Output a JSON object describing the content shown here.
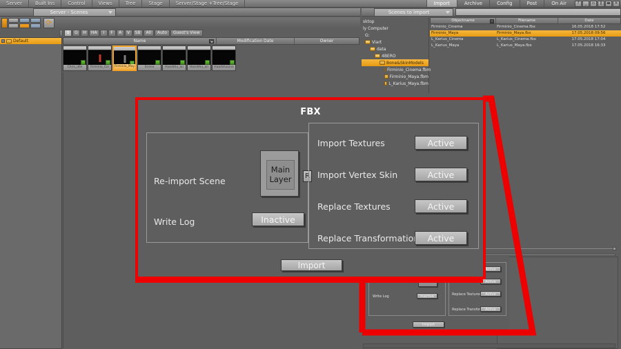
{
  "menu": {
    "items": [
      "Server",
      "Built Ins",
      "Control",
      "Views",
      "Tree",
      "Stage",
      "Server/Stage +Tree/Stage"
    ],
    "right_tabs": [
      {
        "label": "Import",
        "active": true
      },
      {
        "label": "Archive",
        "active": false
      },
      {
        "label": "Config",
        "active": false
      },
      {
        "label": "Post",
        "active": false
      },
      {
        "label": "On Air",
        "active": false
      }
    ],
    "window_buttons": [
      "help-icon",
      "minimize-icon",
      "restore-icon",
      "split-icon",
      "collapse-icon",
      "close-icon"
    ]
  },
  "left_pane": {
    "tab_label": "Server - Scenes",
    "toolbar_icons": [
      "lock-icon",
      "add-icon",
      "remove-icon",
      "folder-new-icon",
      "folder-up-icon",
      "list-icon",
      "list-detail-icon",
      "refresh-icon"
    ],
    "filters": [
      "S",
      "G",
      "H",
      "HA",
      "I",
      "F",
      "A",
      "V",
      "SB",
      "All",
      "Auto",
      "Guest's View"
    ],
    "filter_active": "Guest's View",
    "tree": [
      {
        "label": "Default",
        "selected": true
      }
    ],
    "columns": [
      "Name",
      "Modification Date",
      "Owner"
    ],
    "thumbnails": [
      {
        "caption": "Chris_idle",
        "selected": false,
        "mark": "none"
      },
      {
        "caption": "Firminio_Cin",
        "selected": false,
        "mark": "red"
      },
      {
        "caption": "Firminio_May",
        "selected": true,
        "mark": "gray"
      },
      {
        "caption": "Scene",
        "selected": false,
        "mark": "none"
      },
      {
        "caption": "Haarbhu_an",
        "selected": false,
        "mark": "none"
      },
      {
        "caption": "Haarbhu_an",
        "selected": false,
        "mark": "none"
      },
      {
        "caption": "HaarbhuLine",
        "selected": false,
        "mark": "none"
      }
    ]
  },
  "right_pane": {
    "tab_label": "Scenes to import",
    "tree": [
      {
        "label": "sktop",
        "depth": 0,
        "icon": "none"
      },
      {
        "label": "ly Computer",
        "depth": 0,
        "icon": "none"
      },
      {
        "label": "G:",
        "depth": 1,
        "icon": "none"
      },
      {
        "label": "Viart",
        "depth": 1,
        "icon": "folder"
      },
      {
        "label": "data",
        "depth": 2,
        "icon": "folder"
      },
      {
        "label": "4BERO",
        "depth": 3,
        "icon": "folder"
      },
      {
        "label": "Bone&SkinModels",
        "depth": 4,
        "icon": "folder",
        "selected": true
      },
      {
        "label": "Firminio_Cinema.fbm",
        "depth": 5,
        "icon": "folder"
      },
      {
        "label": "Firminio_Maya.fbm",
        "depth": 5,
        "icon": "folder"
      },
      {
        "label": "L_Karius_Maya.fbm",
        "depth": 5,
        "icon": "folder"
      }
    ],
    "columns": [
      "Objectname",
      "Filename",
      "Date"
    ],
    "rows": [
      {
        "objectname": "Firminio_Cinema",
        "filename": "Firminio_Cinema.fbx",
        "date": "16.05.2018 17:52",
        "selected": false
      },
      {
        "objectname": "Firminio_Maya",
        "filename": "Firminio_Maya.fbx",
        "date": "17.05.2018 09:56",
        "selected": true
      },
      {
        "objectname": "L_Karius_Cinema",
        "filename": "L_Karius_Cinema.fbx",
        "date": "17.05.2018 17:04",
        "selected": false
      },
      {
        "objectname": "L_Karius_Maya",
        "filename": "L_Karius_Maya.fbx",
        "date": "17.05.2018 16:33",
        "selected": false
      }
    ]
  },
  "fbx_dialog": {
    "title": "FBX",
    "left_group": {
      "reimport_scene_label": "Re-import Scene",
      "layer_value": "Main Layer",
      "reset_button_label": "R",
      "write_log_label": "Write Log",
      "write_log_value": "Inactive"
    },
    "right_group": {
      "options": [
        {
          "label": "Import Textures",
          "value": "Active"
        },
        {
          "label": "Import Vertex Skin",
          "value": "Active"
        },
        {
          "label": "Replace Textures",
          "value": "Active"
        },
        {
          "label": "Replace Transformation",
          "value": "Active"
        }
      ]
    },
    "import_button_label": "Import"
  },
  "colors": {
    "callout": "#ef0000",
    "selection": "#f0ad3e",
    "panel_bg": "#5e5e5e",
    "button_face": "#b5b5b5"
  }
}
